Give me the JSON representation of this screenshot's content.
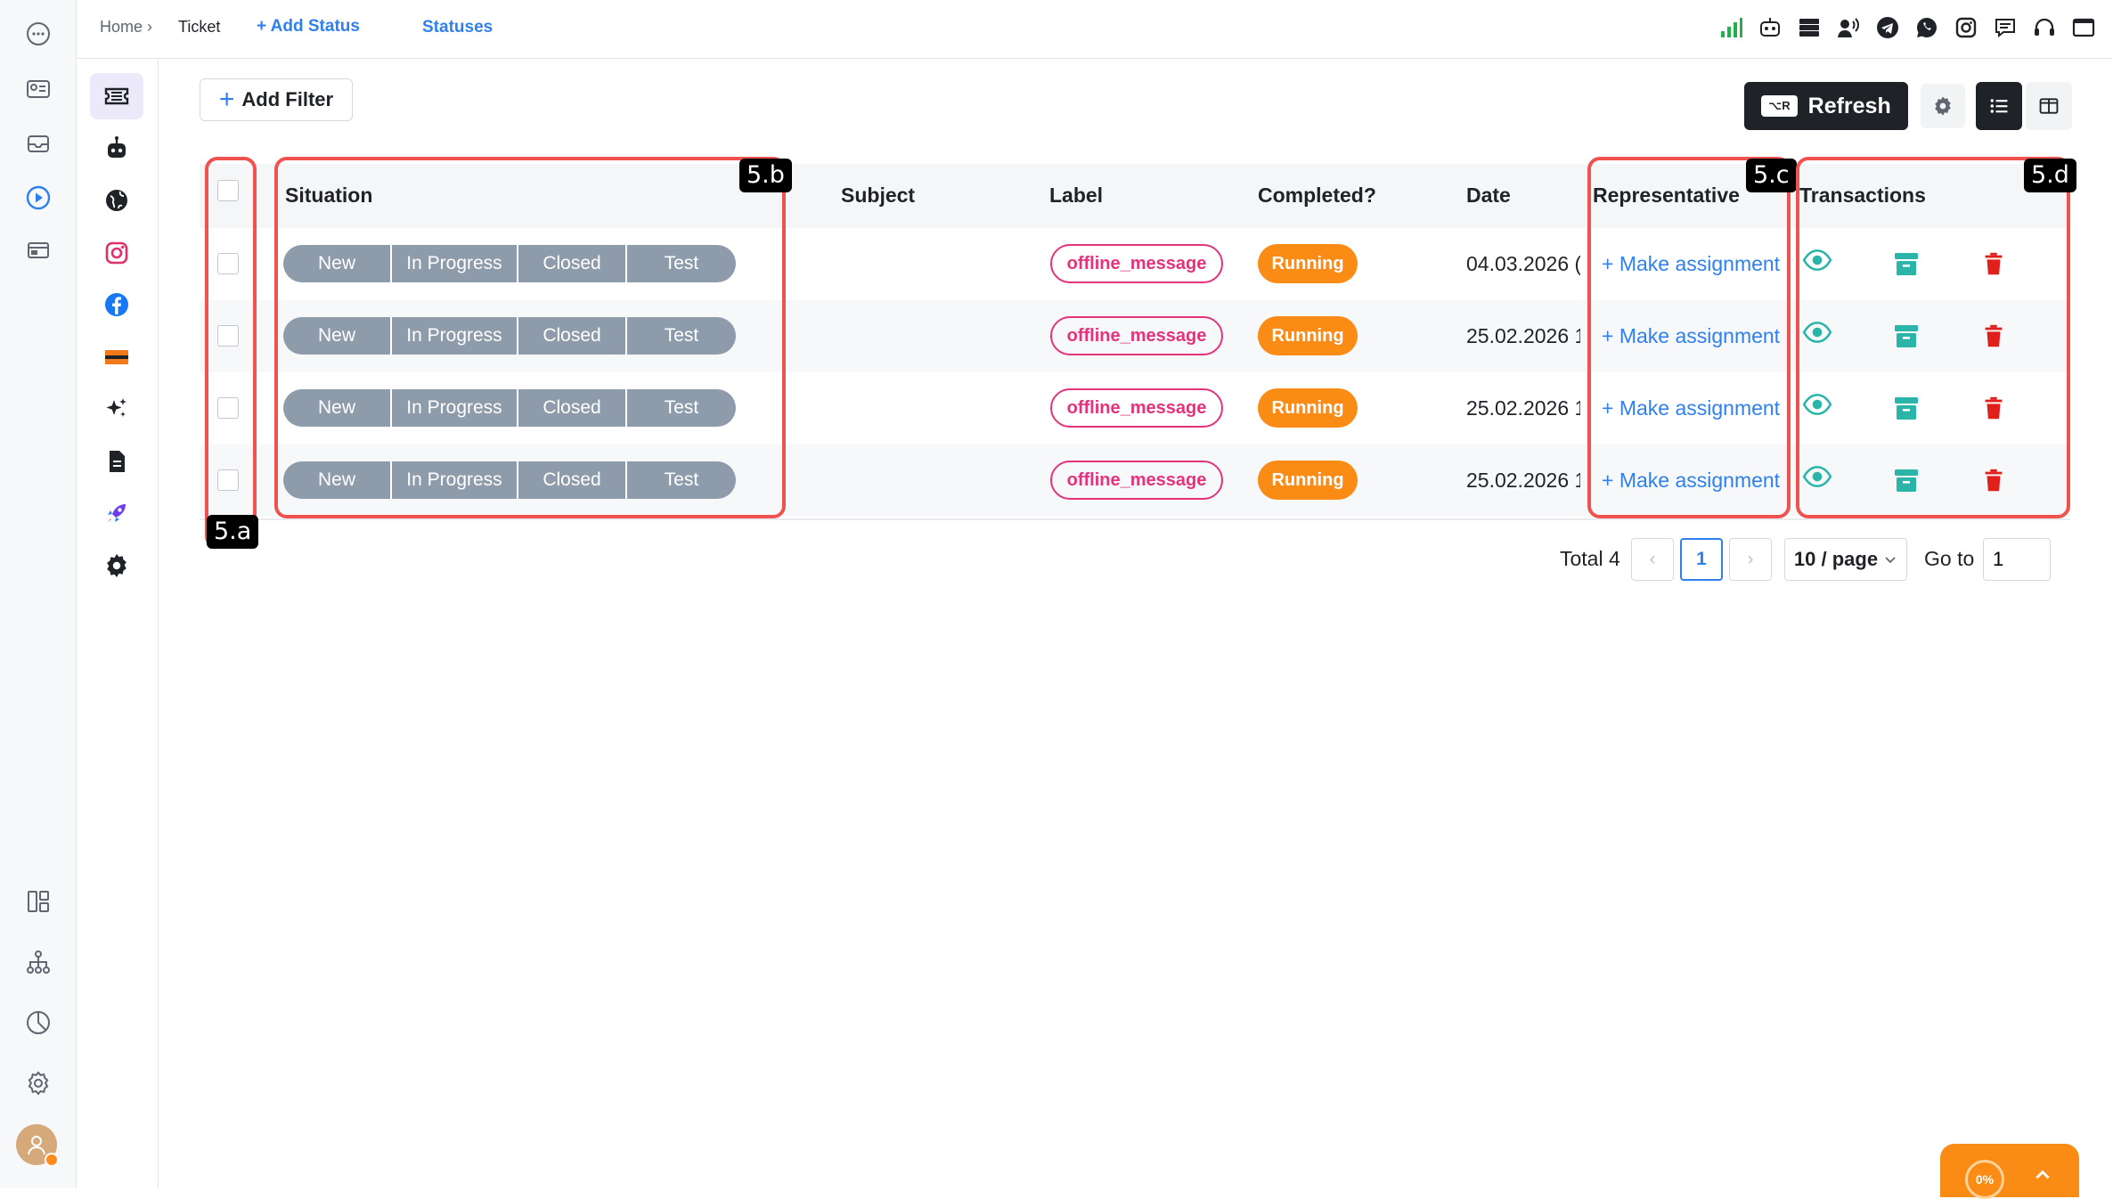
{
  "breadcrumb": {
    "home": "Home ›",
    "current": "Ticket"
  },
  "topbar": {
    "add_status": "+ Add Status",
    "statuses": "Statuses"
  },
  "toolbar": {
    "add_filter": "Add Filter",
    "refresh": "Refresh",
    "refresh_kbd": "⌥R"
  },
  "table": {
    "headers": {
      "situation": "Situation",
      "subject": "Subject",
      "label": "Label",
      "completed": "Completed?",
      "date": "Date",
      "representative": "Representative",
      "transactions": "Transactions"
    },
    "rows": [
      {
        "statuses": [
          "New",
          "In Progress",
          "Closed",
          "Test"
        ],
        "subject": "",
        "label": "offline_message",
        "completed": "Running",
        "date": "04.03.2026 (",
        "assign": "+ Make assignment"
      },
      {
        "statuses": [
          "New",
          "In Progress",
          "Closed",
          "Test"
        ],
        "subject": "",
        "label": "offline_message",
        "completed": "Running",
        "date": "25.02.2026 1",
        "assign": "+ Make assignment"
      },
      {
        "statuses": [
          "New",
          "In Progress",
          "Closed",
          "Test"
        ],
        "subject": "",
        "label": "offline_message",
        "completed": "Running",
        "date": "25.02.2026 1",
        "assign": "+ Make assignment"
      },
      {
        "statuses": [
          "New",
          "In Progress",
          "Closed",
          "Test"
        ],
        "subject": "",
        "label": "offline_message",
        "completed": "Running",
        "date": "25.02.2026 1",
        "assign": "+ Make assignment"
      }
    ]
  },
  "annotations": {
    "a": "5.a",
    "b": "5.b",
    "c": "5.c",
    "d": "5.d"
  },
  "pagination": {
    "total": "Total 4",
    "prev": "‹",
    "current_page": "1",
    "next": "›",
    "page_size": "10 / page",
    "goto_label": "Go to",
    "goto_value": "1"
  },
  "progress_widget": {
    "percent": "0%"
  },
  "colors": {
    "accent": "#2f80ed",
    "label_pink": "#e4337b",
    "running_orange": "#fa8c16",
    "status_gray": "#8e9bab",
    "annotation_red": "#f0524f",
    "eye_teal": "#2bb5a8",
    "delete_red": "#e0201b"
  }
}
